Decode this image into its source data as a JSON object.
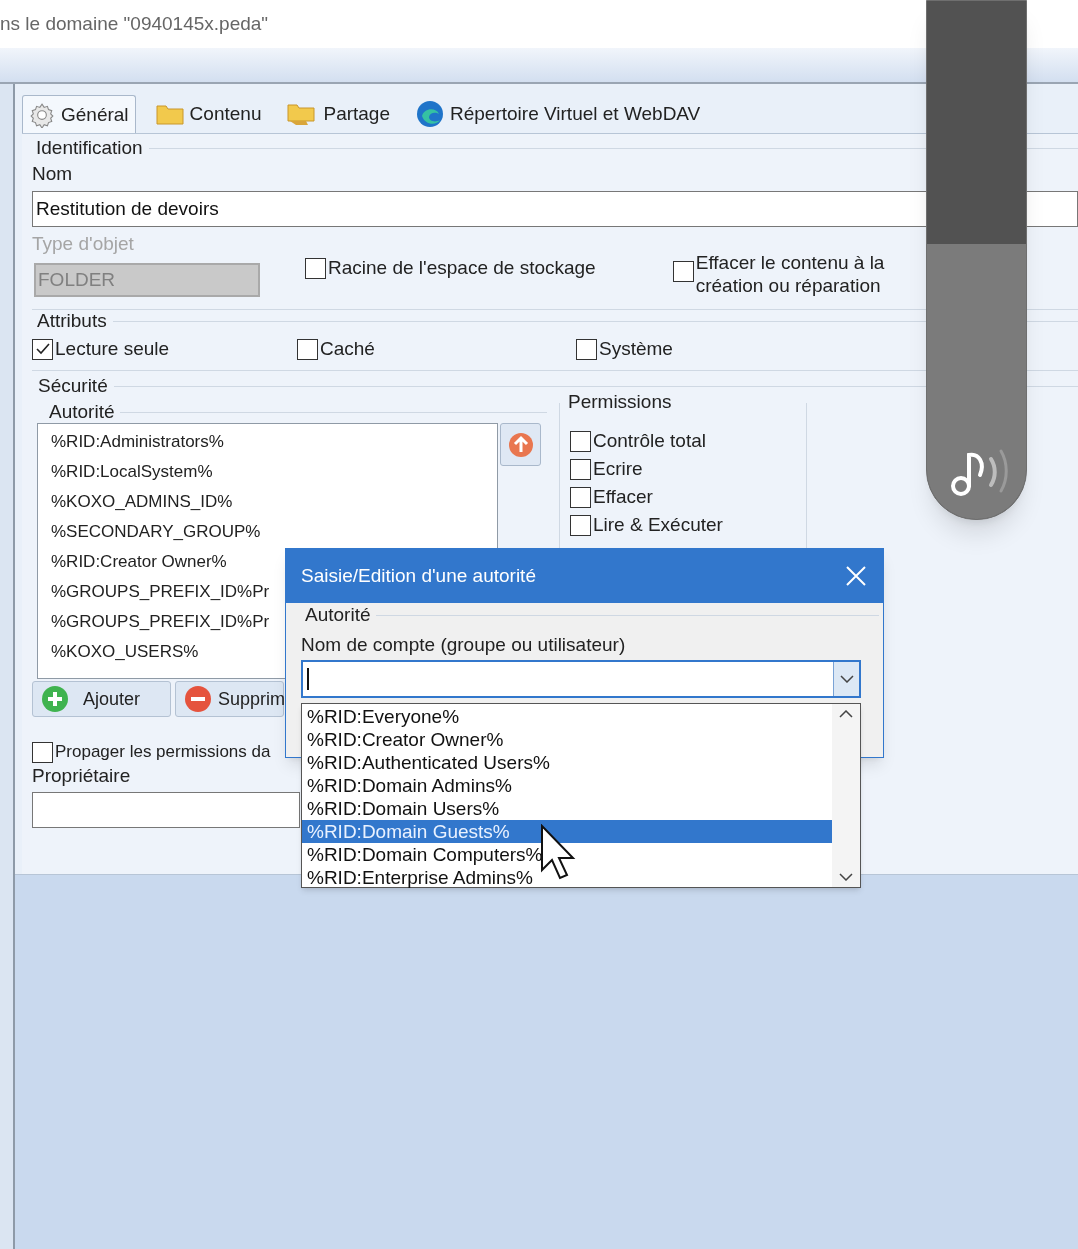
{
  "window": {
    "title": "ns le domaine \"0940145x.peda\""
  },
  "tabs": [
    {
      "label": "Général",
      "kind": "gear",
      "selected": true
    },
    {
      "label": "Contenu",
      "kind": "folder",
      "selected": false
    },
    {
      "label": "Partage",
      "kind": "shared",
      "selected": false
    },
    {
      "label": "Répertoire Virtuel et WebDAV",
      "kind": "globe",
      "selected": false
    }
  ],
  "identification": {
    "title": "Identification",
    "name_label": "Nom",
    "name_value": "Restitution de devoirs",
    "type_label": "Type d'objet",
    "type_value": "FOLDER",
    "options": [
      {
        "label": "Racine de l'espace de stockage",
        "checked": false
      },
      {
        "label": "Effacer le contenu à la création ou réparation",
        "checked": false
      }
    ]
  },
  "attributes": {
    "title": "Attributs",
    "items": [
      {
        "label": "Lecture seule",
        "checked": true
      },
      {
        "label": "Caché",
        "checked": false
      },
      {
        "label": "Système",
        "checked": false
      }
    ]
  },
  "security": {
    "title": "Sécurité",
    "authority": {
      "title": "Autorité",
      "items": [
        "%RID:Administrators%",
        "%RID:LocalSystem%",
        "%KOXO_ADMINS_ID%",
        "%SECONDARY_GROUP%",
        "%RID:Creator Owner%",
        "%GROUPS_PREFIX_ID%Pr",
        "%GROUPS_PREFIX_ID%Pr",
        "%KOXO_USERS%"
      ],
      "buttons": [
        {
          "label": "Ajouter",
          "kind": "add"
        },
        {
          "label": "Supprim",
          "kind": "remove"
        }
      ]
    },
    "permissions": {
      "title": "Permissions",
      "items": [
        {
          "label": "Contrôle total",
          "checked": false
        },
        {
          "label": "Ecrire",
          "checked": false
        },
        {
          "label": "Effacer",
          "checked": false
        },
        {
          "label": "Lire & Exécuter",
          "checked": false
        }
      ]
    },
    "propagate": {
      "label": "Propager les permissions da",
      "checked": false
    },
    "owner_label": "Propriétaire"
  },
  "dialog": {
    "title": "Saisie/Edition d'une autorité",
    "group": "Autorité",
    "account_label": "Nom de compte (groupe ou utilisateur)",
    "options": [
      {
        "label": "%RID:Everyone%",
        "selected": false
      },
      {
        "label": "%RID:Creator Owner%",
        "selected": false
      },
      {
        "label": "%RID:Authenticated Users%",
        "selected": false
      },
      {
        "label": "%RID:Domain Admins%",
        "selected": false
      },
      {
        "label": "%RID:Domain Users%",
        "selected": false
      },
      {
        "label": "%RID:Domain Guests%",
        "selected": true
      },
      {
        "label": "%RID:Domain Computers%",
        "selected": false
      },
      {
        "label": "%RID:Enterprise Admins%",
        "selected": false
      }
    ]
  },
  "volume": {
    "level": 0.53
  }
}
